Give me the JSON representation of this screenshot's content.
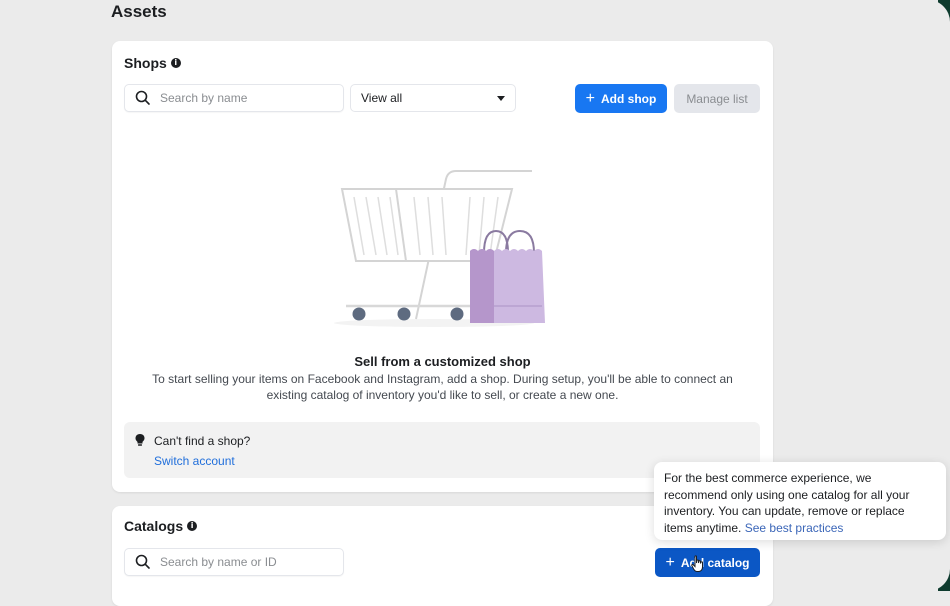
{
  "page": {
    "title": "Assets"
  },
  "shops": {
    "title": "Shops",
    "info_icon": "info-icon",
    "search": {
      "placeholder": "Search by name",
      "value": ""
    },
    "filter": {
      "selected": "View all"
    },
    "add_button": "Add shop",
    "manage_button": "Manage list",
    "empty_state": {
      "illustration": "shopping-cart-with-bag",
      "title": "Sell from a customized shop",
      "description": "To start selling your items on Facebook and Instagram, add a shop. During setup, you'll be able to connect an existing catalog of inventory you'd like to sell, or create a new one."
    },
    "tip": {
      "icon": "lightbulb-icon",
      "text": "Can't find a shop?",
      "link": "Switch account"
    }
  },
  "catalogs": {
    "title": "Catalogs",
    "info_icon": "info-icon",
    "search": {
      "placeholder": "Search by name or ID",
      "value": ""
    },
    "add_button": "Add catalog"
  },
  "tooltip": {
    "text": "For the best commerce experience, we recommend only using one catalog for all your inventory. You can update, remove or replace items anytime. ",
    "link": "See best practices"
  },
  "colors": {
    "primary": "#1877f2",
    "primary_hover": "#0b57c5",
    "link": "#216fdb",
    "bag": "#c9b3dc"
  }
}
